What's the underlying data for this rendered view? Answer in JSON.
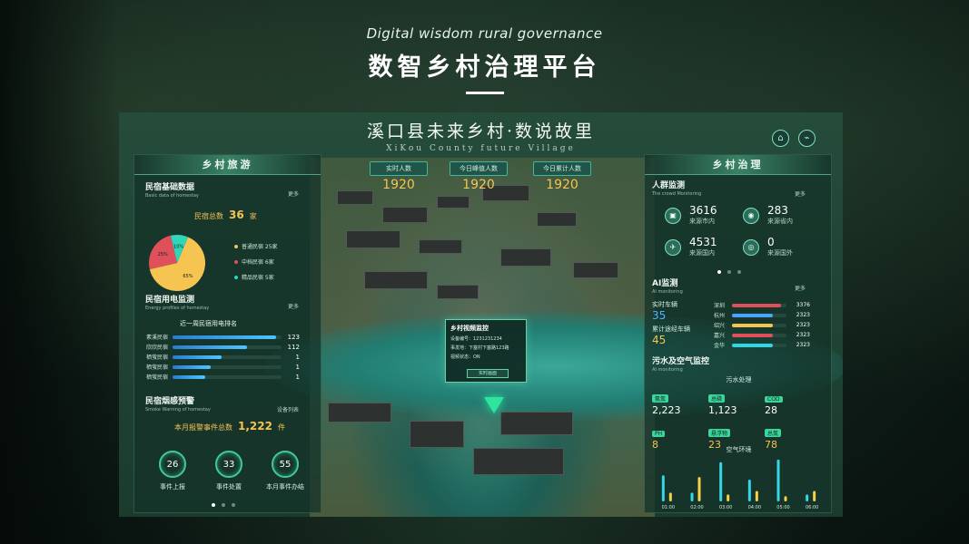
{
  "header": {
    "en_title": "Digital wisdom rural governance",
    "cn_title": "数智乡村治理平台"
  },
  "screen": {
    "title_cn": "溪口县未来乡村·数说故里",
    "title_en": "XiKou County future Village",
    "icons": [
      "home-icon",
      "satellite-icon"
    ]
  },
  "top_stats": [
    {
      "label": "实时人数",
      "value": "1920"
    },
    {
      "label": "今日峰值人数",
      "value": "1920"
    },
    {
      "label": "今日累计人数",
      "value": "1920"
    }
  ],
  "left_panel": {
    "header": "乡村旅游",
    "homestay_basic": {
      "title": "民宿基础数据",
      "subtitle": "Basic data of homestay",
      "more": "更多",
      "total_label": "民宿总数",
      "total_value": "36",
      "total_unit": "家",
      "pie": [
        {
          "label": "普通民宿 25家",
          "pct": "65%",
          "share": 65,
          "color": "#f5c451"
        },
        {
          "label": "中档民宿 6家",
          "pct": "25%",
          "share": 25,
          "color": "#e0505a"
        },
        {
          "label": "精品民宿 5家",
          "pct": "10%",
          "share": 10,
          "color": "#2fd6b8"
        }
      ]
    },
    "power": {
      "title": "民宿用电监测",
      "subtitle": "Energy profiles of homestay",
      "more": "更多",
      "ranking_title": "近一周民宿用电排名",
      "rows": [
        {
          "name": "素溪民宿",
          "value": "123",
          "level": 0.95
        },
        {
          "name": "欣欣民宿",
          "value": "112",
          "level": 0.68
        },
        {
          "name": "栖萤民宿",
          "value": "1",
          "level": 0.45
        },
        {
          "name": "栖萤民宿",
          "value": "1",
          "level": 0.35
        },
        {
          "name": "栖萤民宿",
          "value": "1",
          "level": 0.3
        }
      ]
    },
    "smoke": {
      "title": "民宿烟感预警",
      "subtitle": "Smoke Warning of homestay",
      "device_list": "设备列表",
      "month_label": "本月报警事件总数",
      "month_value": "1,222",
      "month_unit": "件",
      "rings": [
        {
          "value": "26",
          "label": "事件上报"
        },
        {
          "value": "33",
          "label": "事件处置"
        },
        {
          "value": "55",
          "label": "本月事件办结"
        }
      ]
    }
  },
  "popup": {
    "title": "乡村视频监控",
    "device": "设备编号：1231231234",
    "location": "事发地：下塞村下塞路123路",
    "status": "视频状态：ON",
    "button": "实时画面"
  },
  "right_panel": {
    "header": "乡村治理",
    "crowd": {
      "title": "人群监测",
      "subtitle": "The crowd Monitoring",
      "more": "更多",
      "items": [
        {
          "icon": "bus-icon",
          "value": "3616",
          "label": "来源市内"
        },
        {
          "icon": "car-icon",
          "value": "283",
          "label": "来源省内"
        },
        {
          "icon": "plane-icon",
          "value": "4531",
          "label": "来源国内"
        },
        {
          "icon": "globe-icon",
          "value": "0",
          "label": "来源国外"
        }
      ]
    },
    "ai": {
      "title": "AI监测",
      "subtitle": "AI monitoring",
      "more": "更多",
      "realtime_label": "实时车辆",
      "realtime_value": "35",
      "cumulative_label": "累计途经车辆",
      "cumulative_value": "45",
      "rows": [
        {
          "name": "深圳",
          "value": "3376",
          "color": "#e0505a",
          "level": 0.9
        },
        {
          "name": "杭州",
          "value": "2323",
          "color": "#4aa3ff",
          "level": 0.75
        },
        {
          "name": "绍兴",
          "value": "2323",
          "color": "#f5c451",
          "level": 0.75
        },
        {
          "name": "嘉兴",
          "value": "2323",
          "color": "#e0505a",
          "level": 0.75
        },
        {
          "name": "金华",
          "value": "2323",
          "color": "#2fd6e5",
          "level": 0.75
        }
      ]
    },
    "env": {
      "title": "污水及空气监控",
      "subtitle": "AI monitoring",
      "sewage_title": "污水处理",
      "sewage": [
        {
          "label": "氨氮",
          "value": "2,223",
          "yellow": false
        },
        {
          "label": "总磷",
          "value": "1,123",
          "yellow": false
        },
        {
          "label": "COD",
          "value": "28",
          "yellow": false
        },
        {
          "label": "PH",
          "value": "8",
          "yellow": true
        },
        {
          "label": "悬浮物",
          "value": "23",
          "yellow": true
        },
        {
          "label": "总氮",
          "value": "78",
          "yellow": true
        }
      ],
      "air_title": "空气环境",
      "air_chart": {
        "type": "bar",
        "categories": [
          "01:00",
          "02:00",
          "03:00",
          "04:00",
          "05:00",
          "06:00"
        ],
        "series": [
          {
            "values": [
              30,
              10,
              45,
              25,
              48,
              8
            ],
            "color": "#35d6e8"
          },
          {
            "values": [
              10,
              28,
              8,
              12,
              6,
              12
            ],
            "color": "#f5d14a"
          }
        ]
      }
    }
  }
}
